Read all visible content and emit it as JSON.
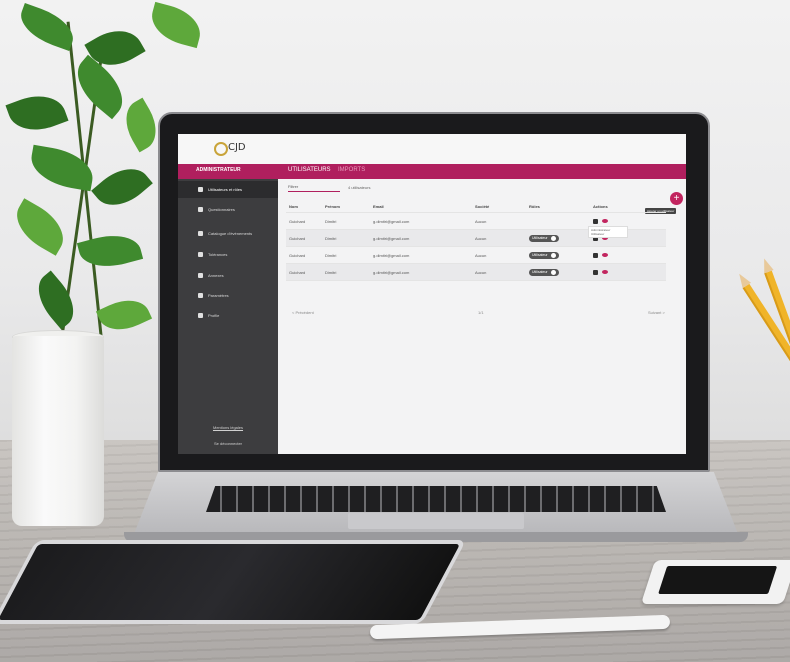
{
  "app": {
    "logo_text": "CJD",
    "role_title": "ADMINISTRATEUR",
    "tabs": [
      {
        "label": "UTILISATEURS"
      },
      {
        "label": "IMPORTS"
      }
    ]
  },
  "sidebar": {
    "items": [
      {
        "label": "Utilisateurs et rôles"
      },
      {
        "label": "Questionnaires"
      },
      {
        "label": "Catalogue d'évènements"
      },
      {
        "label": "Tolérances"
      },
      {
        "label": "Annexes"
      },
      {
        "label": "Paramètres"
      },
      {
        "label": "Profile"
      }
    ],
    "footer_link": "Mentions légales",
    "logout": "Se déconnecter"
  },
  "filter": {
    "label": "Filtrer",
    "count": "4 utilisateurs"
  },
  "table": {
    "headers": [
      "Nom",
      "Prénom",
      "Email",
      "Société",
      "Rôles",
      "Actions"
    ],
    "rows": [
      {
        "nom": "Guichard",
        "prenom": "Dimitri",
        "email": "g.dimitri@gmail.com",
        "societe": "Aucun",
        "role": ""
      },
      {
        "nom": "Guichard",
        "prenom": "Dimitri",
        "email": "g.dimitri@gmail.com",
        "societe": "Aucun",
        "role": "Utilisateur"
      },
      {
        "nom": "Guichard",
        "prenom": "Dimitri",
        "email": "g.dimitri@gmail.com",
        "societe": "Aucun",
        "role": "Utilisateur"
      },
      {
        "nom": "Guichard",
        "prenom": "Dimitri",
        "email": "g.dimitri@gmail.com",
        "societe": "Aucun",
        "role": "Utilisateur"
      }
    ]
  },
  "add_button": {
    "symbol": "+",
    "tooltip": "Ajouter un utilisateur"
  },
  "role_menu": {
    "options": [
      "Administrateur",
      "Utilisateur"
    ]
  },
  "pagination": {
    "prev": "< Précédent",
    "page": "1/1",
    "next": "Suivant >"
  },
  "colors": {
    "accent": "#b01f5e",
    "sidebar": "#3d3d3f"
  }
}
